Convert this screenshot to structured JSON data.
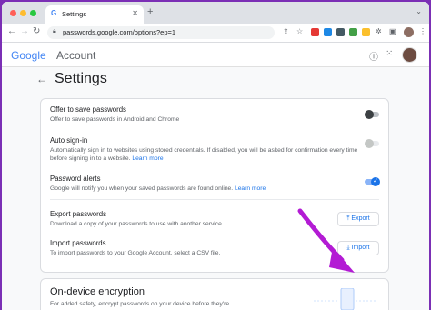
{
  "browser": {
    "tab_title": "Settings",
    "tab_icon": "G",
    "url": "passwords.google.com/options?ep=1",
    "new_tab": "+",
    "close_tab": "✕"
  },
  "header": {
    "logo_google": "Google",
    "logo_account": "Account"
  },
  "page": {
    "title": "Settings",
    "back": "←"
  },
  "settings": [
    {
      "title": "Offer to save passwords",
      "desc": "Offer to save passwords in Android and Chrome",
      "toggle": "off"
    },
    {
      "title": "Auto sign-in",
      "desc": "Automatically sign in to websites using stored credentials. If disabled, you will be asked for confirmation every time before signing in to a website.",
      "link": "Learn more",
      "toggle": "disabled"
    },
    {
      "title": "Password alerts",
      "desc": "Google will notify you when your saved passwords are found online.",
      "link": "Learn more",
      "toggle": "on"
    },
    {
      "title": "Export passwords",
      "desc": "Download a copy of your passwords to use with another service",
      "button": "Export"
    },
    {
      "title": "Import passwords",
      "desc": "To import passwords to your Google Account, select a CSV file.",
      "button": "Import"
    }
  ],
  "encryption": {
    "title": "On-device encryption",
    "desc": "For added safety, encrypt passwords on your device before they're"
  },
  "colors": {
    "accent": "#1a73e8",
    "frame": "#7b2fb5",
    "arrow": "#b31bd4"
  }
}
